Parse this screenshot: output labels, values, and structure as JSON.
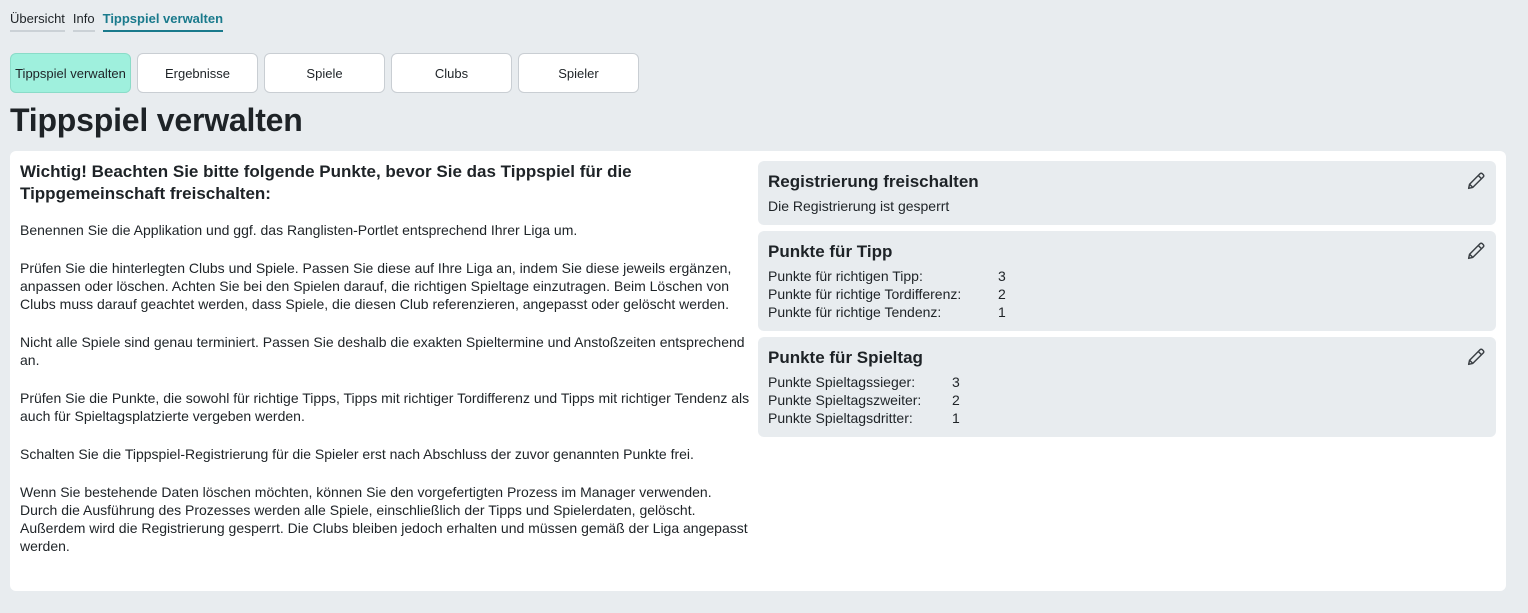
{
  "top_tabs": [
    "Übersicht",
    "Info",
    "Tippspiel verwalten"
  ],
  "nav_buttons": [
    "Tippspiel verwalten",
    "Ergebnisse",
    "Spiele",
    "Clubs",
    "Spieler"
  ],
  "page_title": "Tippspiel verwalten",
  "warning": {
    "title": "Wichtig! Beachten Sie bitte folgende Punkte, bevor Sie das Tippspiel für die Tippgemeinschaft freischalten:",
    "paragraphs": [
      "Benennen Sie die Applikation und ggf. das Ranglisten-Portlet entsprechend Ihrer Liga um.",
      "Prüfen Sie die hinterlegten Clubs und Spiele. Passen Sie diese auf Ihre Liga an, indem Sie diese jeweils ergänzen, anpassen oder löschen. Achten Sie bei den Spielen darauf, die richtigen Spieltage einzutragen. Beim Löschen von Clubs muss darauf geachtet werden, dass Spiele, die diesen Club referenzieren, angepasst oder gelöscht werden.",
      "Nicht alle Spiele sind genau terminiert. Passen Sie deshalb die exakten Spieltermine und Anstoßzeiten entsprechend an.",
      "Prüfen Sie die Punkte, die sowohl für richtige Tipps, Tipps mit richtiger Tordifferenz und Tipps mit richtiger Tendenz als auch für Spieltagsplatzierte vergeben werden.",
      "Schalten Sie die Tippspiel-Registrierung für die Spieler erst nach Abschluss der zuvor genannten Punkte frei.",
      "Wenn Sie bestehende Daten löschen möchten, können Sie den vorgefertigten Prozess im Manager verwenden. Durch die Ausführung des Prozesses werden alle Spiele, einschließlich der Tipps und Spielerdaten, gelöscht. Außerdem wird die Registrierung gesperrt. Die Clubs bleiben jedoch erhalten und müssen gemäß der Liga angepasst werden."
    ]
  },
  "registration": {
    "title": "Registrierung freischalten",
    "status": "Die Registrierung ist gesperrt"
  },
  "tip_points": {
    "title": "Punkte für Tipp",
    "rows": [
      {
        "label": "Punkte für richtigen Tipp:",
        "value": "3"
      },
      {
        "label": "Punkte für richtige Tordifferenz:",
        "value": "2"
      },
      {
        "label": "Punkte für richtige Tendenz:",
        "value": "1"
      }
    ]
  },
  "matchday_points": {
    "title": "Punkte für Spieltag",
    "rows": [
      {
        "label": "Punkte Spieltagssieger:",
        "value": "3"
      },
      {
        "label": "Punkte Spieltagszweiter:",
        "value": "2"
      },
      {
        "label": "Punkte Spieltagsdritter:",
        "value": "1"
      }
    ]
  },
  "icons": {
    "edit": "pencil-icon"
  }
}
